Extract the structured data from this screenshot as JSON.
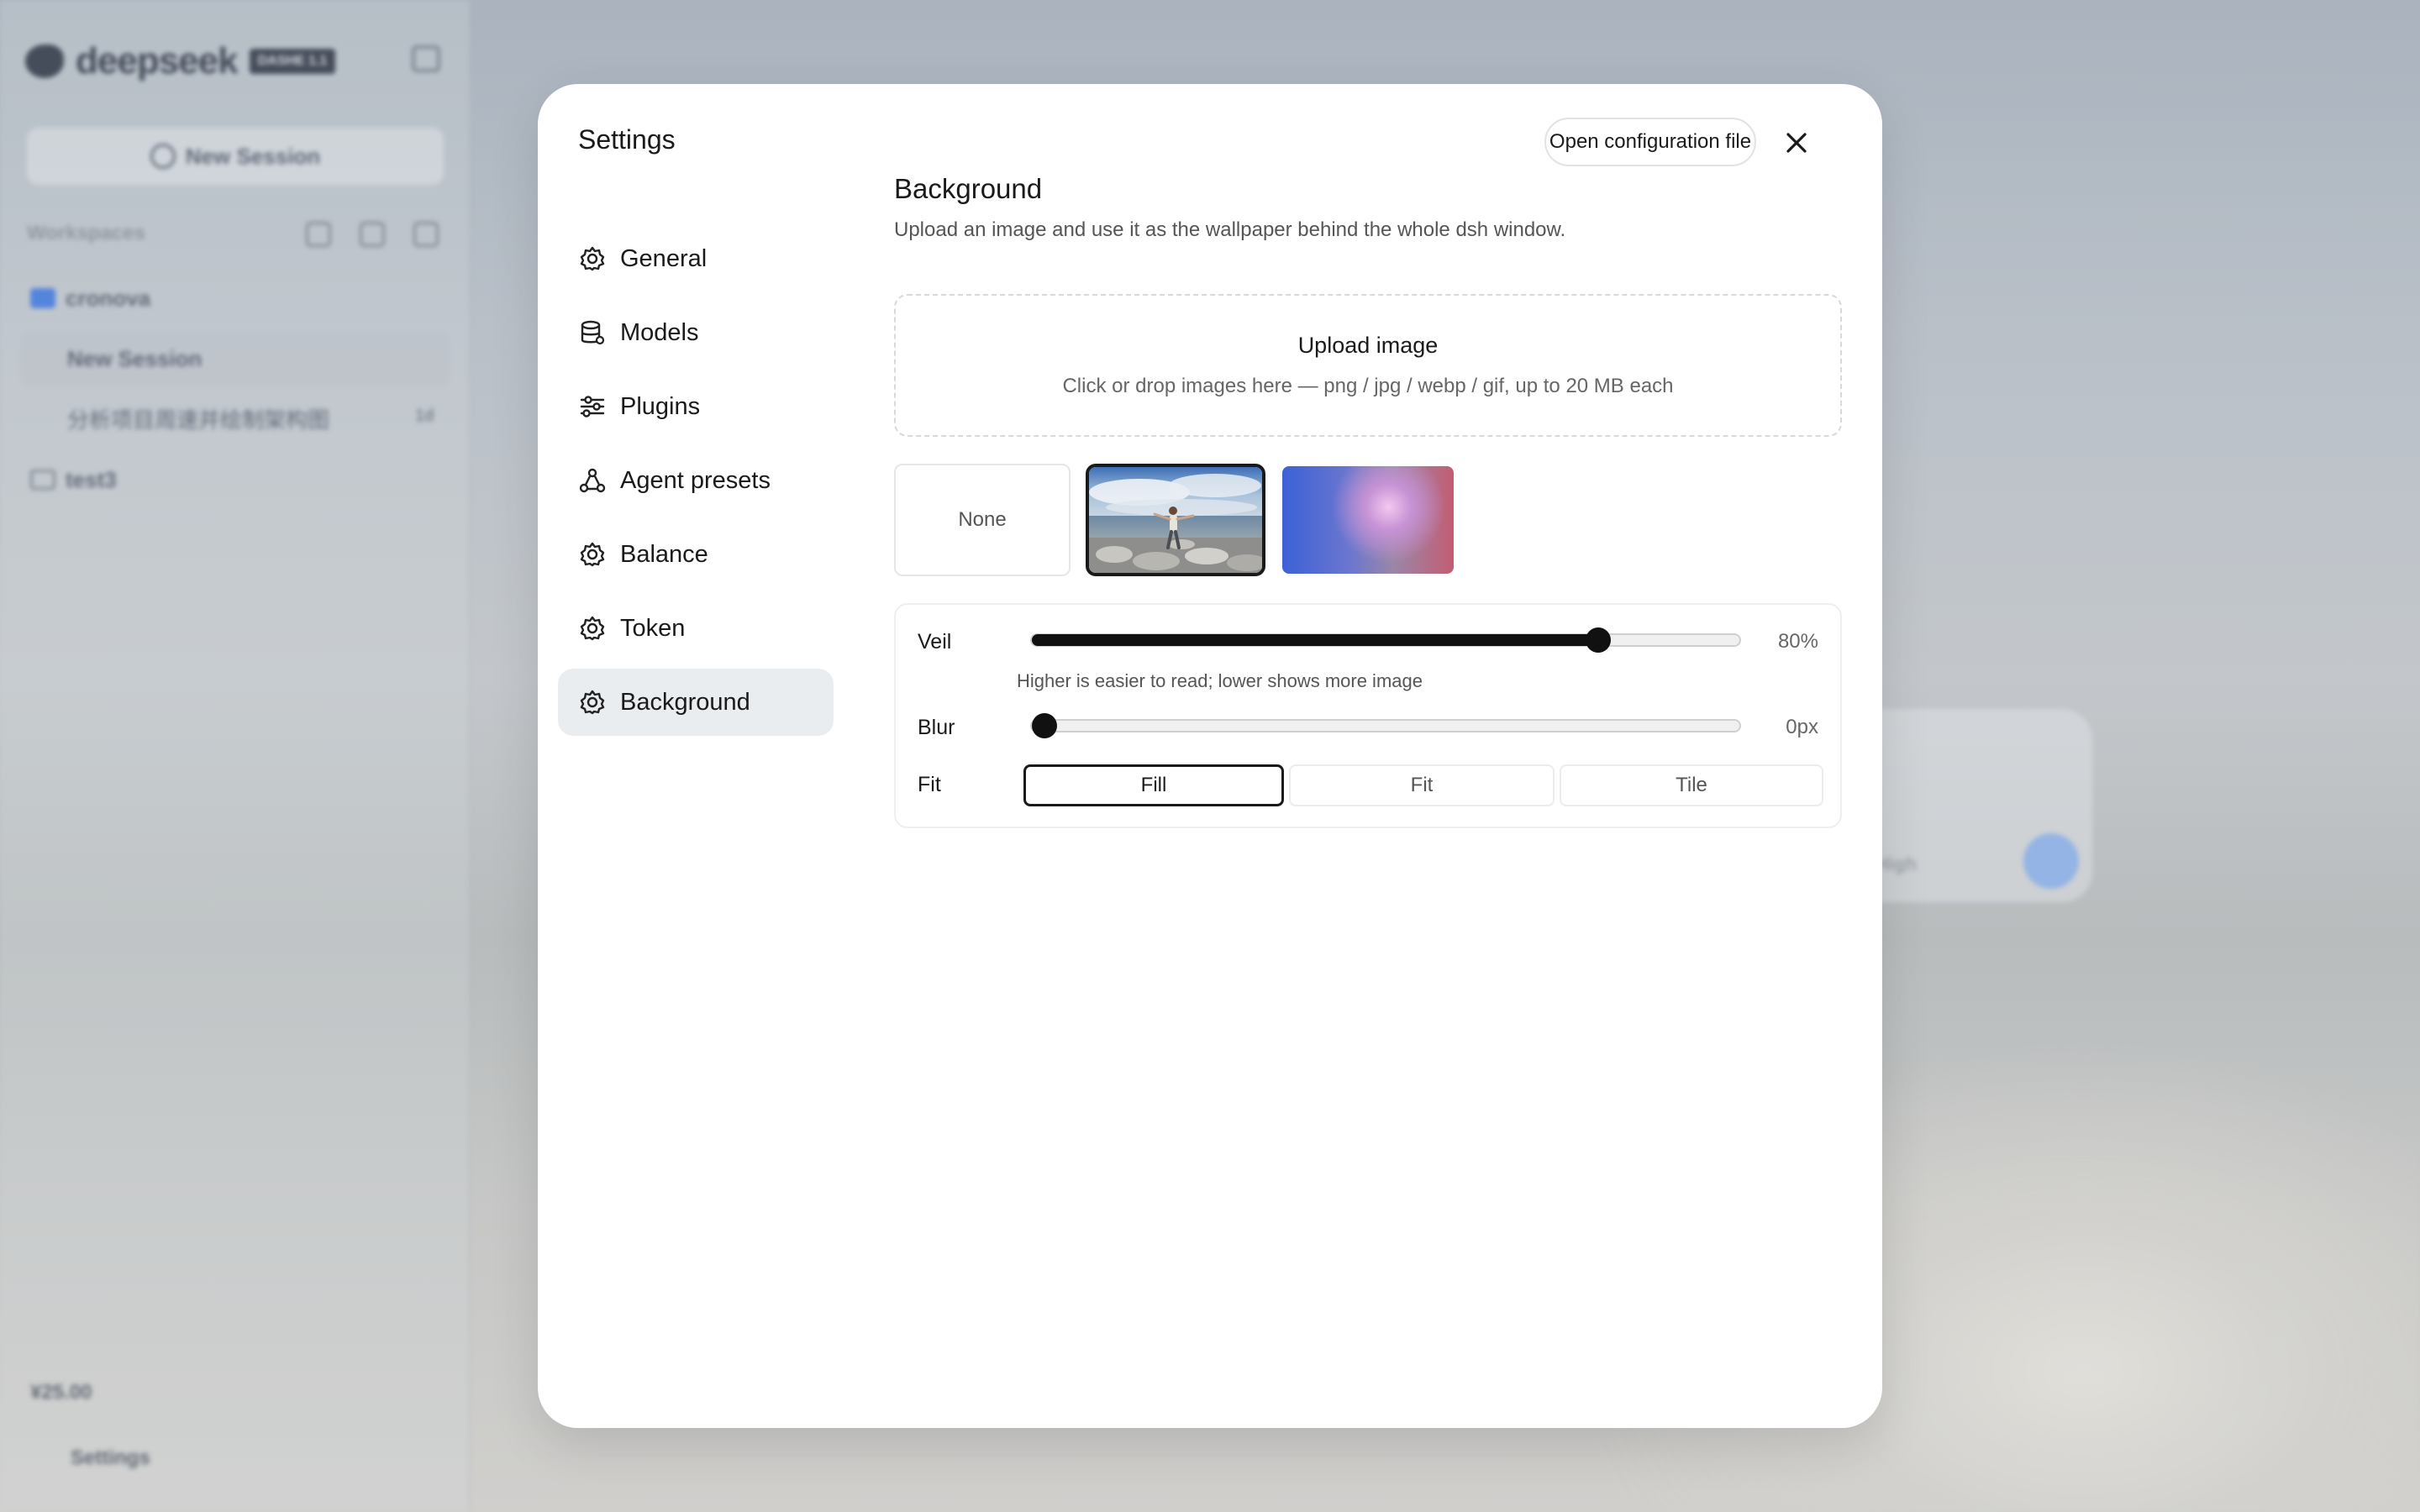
{
  "background_app": {
    "brand": "deepseek",
    "badge": "DASHE 1.1",
    "new_session_label": "New Session",
    "workspaces_label": "Workspaces",
    "workspaces": [
      {
        "name": "cronova",
        "sessions": [
          {
            "title": "New Session",
            "active": true
          },
          {
            "title": "分析项目周速并绘制架构图",
            "age": "1d"
          }
        ]
      },
      {
        "name": "test3"
      }
    ],
    "balance": "¥25.00",
    "settings_label": "Settings",
    "composer_hint": "High"
  },
  "modal": {
    "title": "Settings",
    "open_config_label": "Open configuration file",
    "close_icon": "close-icon",
    "nav": [
      {
        "label": "General",
        "icon": "gear-icon"
      },
      {
        "label": "Models",
        "icon": "database-icon"
      },
      {
        "label": "Plugins",
        "icon": "sliders-icon"
      },
      {
        "label": "Agent presets",
        "icon": "network-icon"
      },
      {
        "label": "Balance",
        "icon": "gear-icon"
      },
      {
        "label": "Token",
        "icon": "gear-icon"
      },
      {
        "label": "Background",
        "icon": "gear-icon",
        "active": true
      }
    ]
  },
  "background_section": {
    "title": "Background",
    "description": "Upload an image and use it as the wallpaper behind the whole dsh window.",
    "upload": {
      "title": "Upload image",
      "subtitle": "Click or drop images here — png / jpg / webp / gif, up to 20 MB each"
    },
    "presets": {
      "none_label": "None",
      "selected": "photo"
    },
    "veil": {
      "label": "Veil",
      "value": 80,
      "display": "80%",
      "hint": "Higher is easier to read; lower shows more image"
    },
    "blur": {
      "label": "Blur",
      "value": 0,
      "max": 20,
      "display": "0px"
    },
    "fit": {
      "label": "Fit",
      "options": [
        "Fill",
        "Fit",
        "Tile"
      ],
      "selected": "Fill"
    }
  },
  "colors": {
    "accent": "#111111",
    "active_nav_bg": "#eaedf0",
    "folder_blue": "#4a7fe0"
  }
}
